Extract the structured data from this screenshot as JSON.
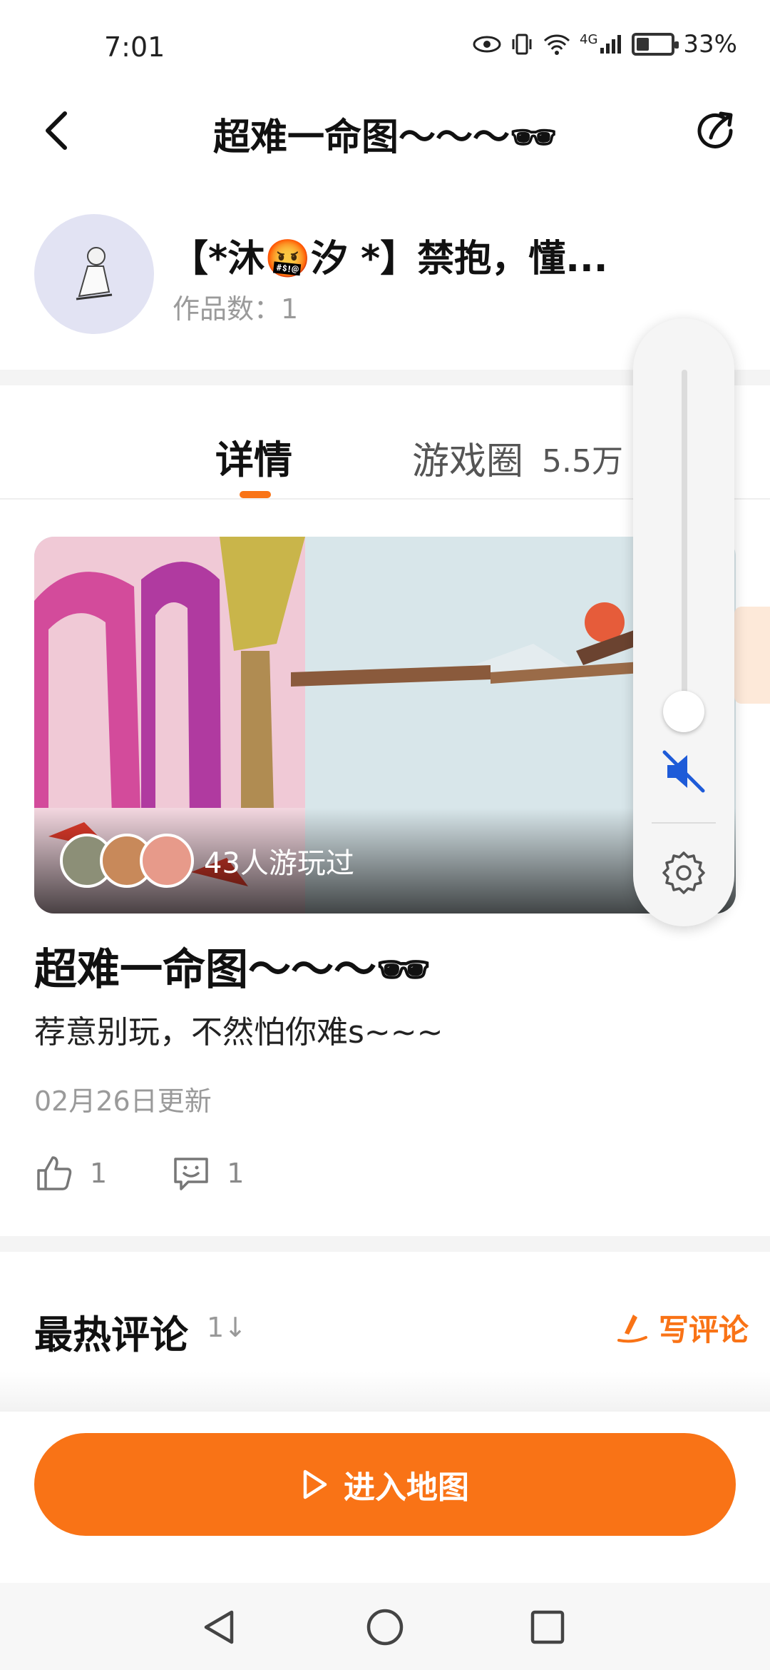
{
  "status_bar": {
    "time": "7:01",
    "network": "4G",
    "battery": "33%",
    "battery_level": 0.33
  },
  "header": {
    "title": "超难一命图～～～🕶"
  },
  "author": {
    "name": "【*沐🤬汐 *】禁抱，懂...",
    "works": "作品数：1"
  },
  "tabs": {
    "detail": "详情",
    "circle": "游戏圈",
    "circle_count": "5.5万"
  },
  "banner": {
    "played_text": "43人游玩过"
  },
  "volume_panel": {
    "level": 0.05,
    "muted": true
  },
  "game": {
    "title": "超难一命图～～～🕶",
    "description": "荐意别玩，不然怕你难s~~~",
    "updated": "02月26日更新",
    "likes": "1",
    "comments": "1"
  },
  "comments": {
    "title": "最热评论",
    "sort_icon": "1↓",
    "write": "写评论"
  },
  "cta": {
    "label": "进入地图"
  },
  "colors": {
    "accent": "#f97316",
    "mute_blue": "#1e5bd8"
  }
}
